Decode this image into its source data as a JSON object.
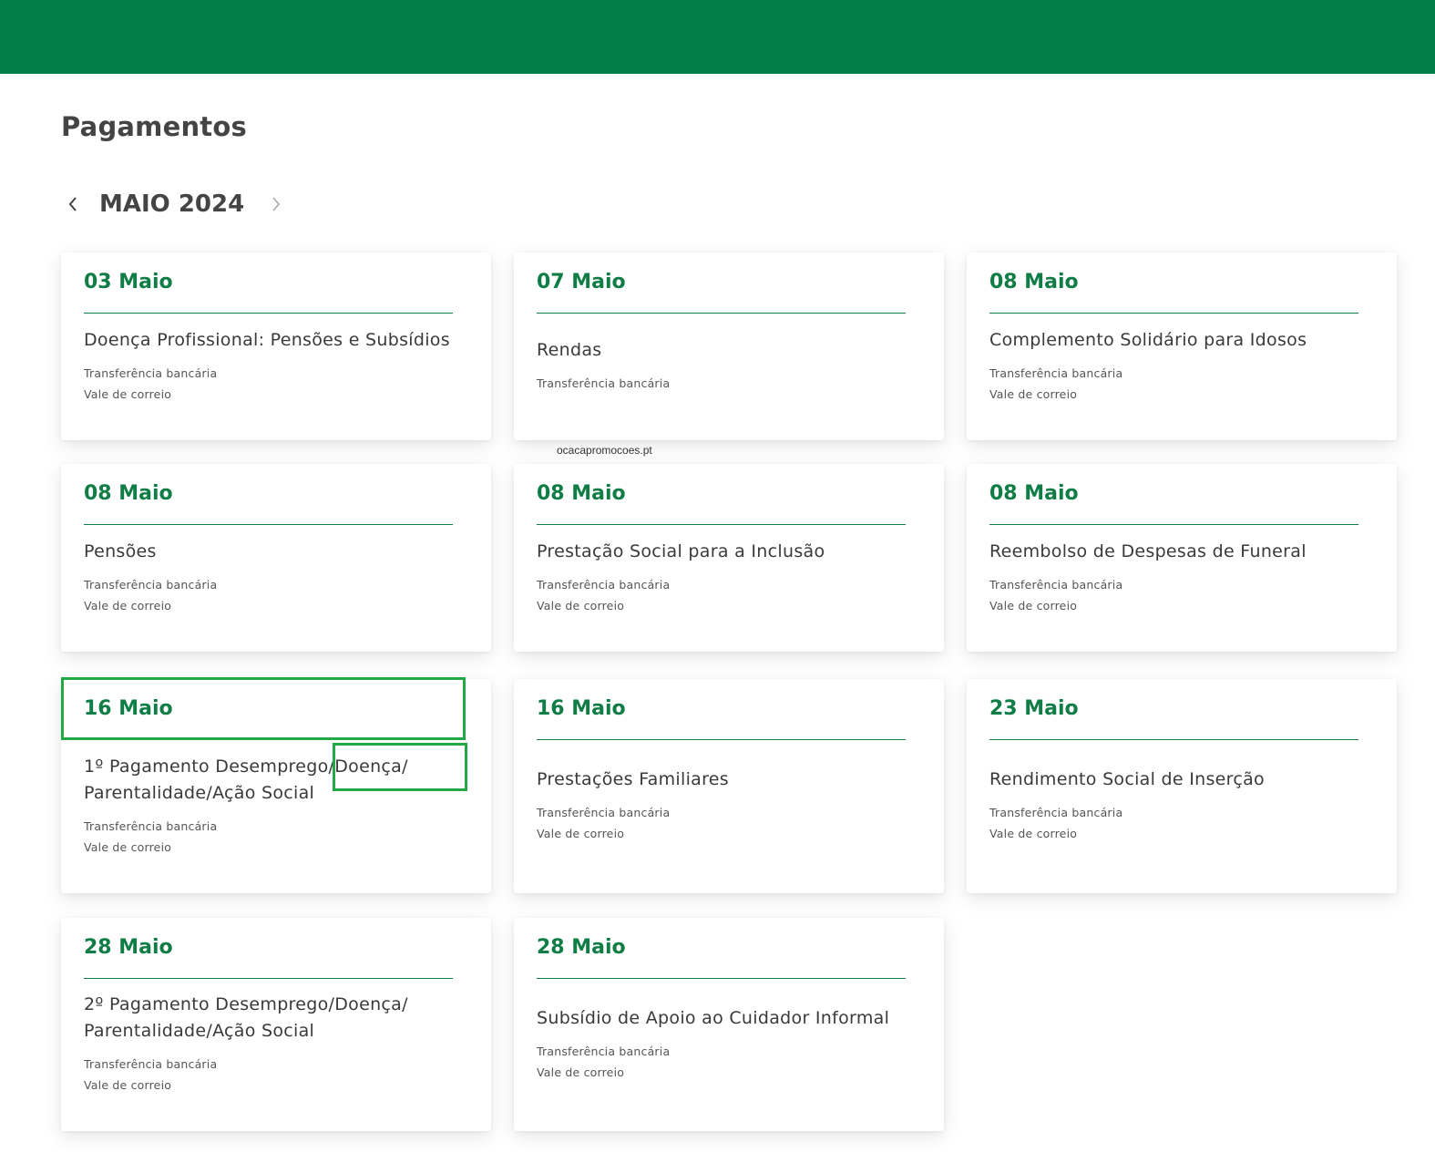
{
  "page": {
    "title": "Pagamentos",
    "month": "MAIO 2024",
    "prev_icon": "chevron-left-icon",
    "next_icon": "chevron-right-icon",
    "watermark": "ocacapromocoes.pt"
  },
  "colors": {
    "topbar": "#007f46",
    "accent": "#0f7d45",
    "highlight": "#22a845"
  },
  "cards": [
    {
      "date": "03 Maio",
      "title": "Doença Profissional: Pensões e Subsídios",
      "methods": [
        "Transferência bancária",
        "Vale de correio"
      ]
    },
    {
      "date": "07 Maio",
      "title": "Rendas",
      "methods": [
        "Transferência bancária"
      ]
    },
    {
      "date": "08 Maio",
      "title": "Complemento Solidário para Idosos",
      "methods": [
        "Transferência bancária",
        "Vale de correio"
      ]
    },
    {
      "date": "08 Maio",
      "title": "Pensões",
      "methods": [
        "Transferência bancária",
        "Vale de correio"
      ]
    },
    {
      "date": "08 Maio",
      "title": "Prestação Social para a Inclusão",
      "methods": [
        "Transferência bancária",
        "Vale de correio"
      ]
    },
    {
      "date": "08 Maio",
      "title": "Reembolso de Despesas de Funeral",
      "methods": [
        "Transferência bancária",
        "Vale de correio"
      ]
    },
    {
      "date": "16 Maio",
      "title": "1º Pagamento Desemprego/Doença/ Parentalidade/Ação Social",
      "methods": [
        "Transferência bancária",
        "Vale de correio"
      ]
    },
    {
      "date": "16 Maio",
      "title": "Prestações Familiares",
      "methods": [
        "Transferência bancária",
        "Vale de correio"
      ]
    },
    {
      "date": "23 Maio",
      "title": "Rendimento Social de Inserção",
      "methods": [
        "Transferência bancária",
        "Vale de correio"
      ]
    },
    {
      "date": "28 Maio",
      "title": "2º Pagamento Desemprego/Doença/ Parentalidade/Ação Social",
      "methods": [
        "Transferência bancária",
        "Vale de correio"
      ]
    },
    {
      "date": "28 Maio",
      "title": "Subsídio de Apoio ao Cuidador Informal",
      "methods": [
        "Transferência bancária",
        "Vale de correio"
      ]
    }
  ]
}
